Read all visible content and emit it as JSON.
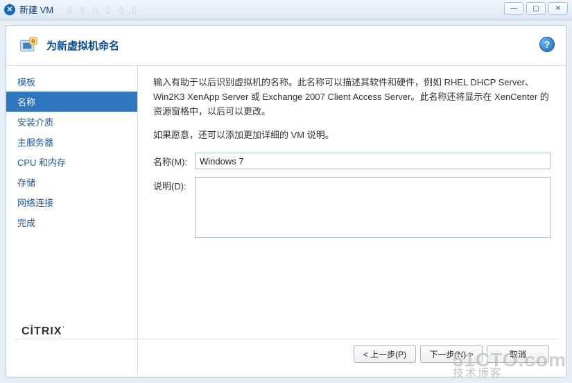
{
  "window": {
    "title": "新建 VM",
    "ghost_tabs": [
      "",
      "",
      "",
      "",
      "",
      ""
    ]
  },
  "header": {
    "title": "为新虚拟机命名"
  },
  "sidebar": {
    "items": [
      {
        "label": "模板"
      },
      {
        "label": "名称"
      },
      {
        "label": "安装介质"
      },
      {
        "label": "主服务器"
      },
      {
        "label": "CPU 和内存"
      },
      {
        "label": "存储"
      },
      {
        "label": "网络连接"
      },
      {
        "label": "完成"
      }
    ],
    "active_index": 1
  },
  "content": {
    "para1": "输入有助于以后识别虚拟机的名称。此名称可以描述其软件和硬件，例如 RHEL DHCP Server、Win2K3 XenApp Server 或 Exchange 2007 Client Access Server。此名称还将显示在 XenCenter 的资源窗格中，以后可以更改。",
    "para2": "如果愿意，还可以添加更加详细的 VM 说明。",
    "name_label": "名称(M):",
    "name_value": "Windows 7",
    "desc_label": "说明(D):",
    "desc_value": ""
  },
  "brand": "CITRIX",
  "footer": {
    "prev": "< 上一步(P)",
    "next": "下一步(N) >",
    "cancel": "取消"
  },
  "watermark": {
    "main": "51CTO.com",
    "sub": "技术博客"
  }
}
